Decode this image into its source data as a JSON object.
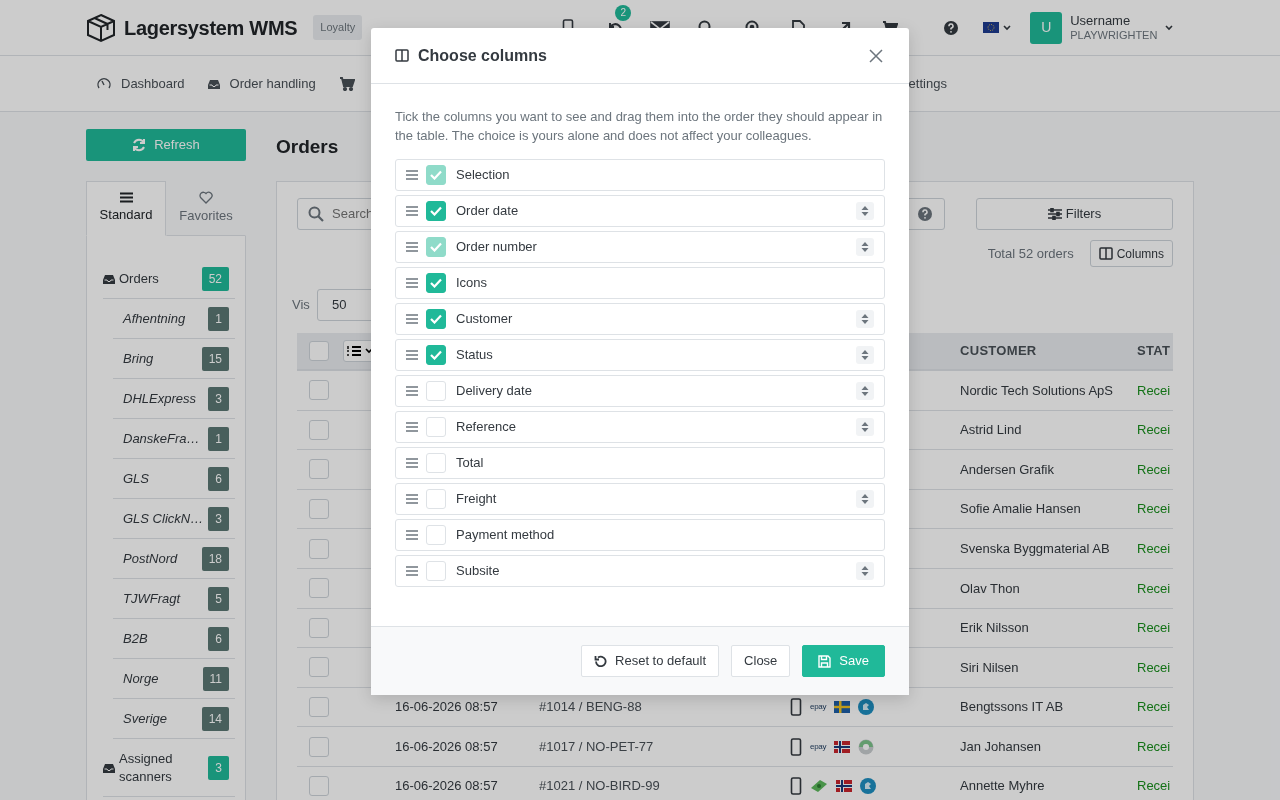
{
  "header": {
    "brand": "Lagersystem WMS",
    "plan_badge": "Loyalty",
    "notification_count": "2",
    "user": {
      "initial": "U",
      "name": "Username",
      "company": "PLAYWRIGHTEN"
    }
  },
  "subnav": [
    {
      "kind": "gauge",
      "label": "Dashboard"
    },
    {
      "kind": "inbox",
      "label": "Order handling"
    },
    {
      "kind": "cart"
    },
    {
      "kind": "plain",
      "label": "ettings"
    }
  ],
  "refresh_button": "Refresh",
  "page_title": "Orders",
  "sidebar": {
    "tabs": [
      {
        "kind": "list",
        "label": "Standard",
        "selected": true
      },
      {
        "kind": "heart",
        "label": "Favorites",
        "selected": false
      }
    ],
    "items": [
      {
        "kind": "folder",
        "label": "Orders",
        "count": "52"
      },
      {
        "kind": "carrier",
        "label": "Afhentning",
        "count": "1"
      },
      {
        "kind": "carrier",
        "label": "Bring",
        "count": "15"
      },
      {
        "kind": "carrier",
        "label": "DHLExpress",
        "count": "3"
      },
      {
        "kind": "carrier",
        "label": "DanskeFra…",
        "count": "1"
      },
      {
        "kind": "carrier",
        "label": "GLS",
        "count": "6"
      },
      {
        "kind": "carrier",
        "label": "GLS ClickN…",
        "count": "3"
      },
      {
        "kind": "carrier",
        "label": "PostNord",
        "count": "18"
      },
      {
        "kind": "carrier",
        "label": "TJWFragt",
        "count": "5"
      },
      {
        "kind": "carrier",
        "label": "B2B",
        "count": "6"
      },
      {
        "kind": "carrier",
        "label": "Norge",
        "count": "11"
      },
      {
        "kind": "carrier",
        "label": "Sverige",
        "count": "14"
      },
      {
        "kind": "folder",
        "label": "Assigned scanners",
        "count": "3"
      }
    ]
  },
  "toolbar": {
    "search_placeholder": "Search",
    "filters_button": "Filters",
    "total": "Total 52 orders",
    "columns_button": "Columns",
    "page_size_label": "Vis",
    "page_size": "50"
  },
  "table": {
    "select_all_checked": false,
    "columns": [
      "CUSTOMER",
      "STAT"
    ],
    "rows": [
      {
        "checked": false,
        "customer": "Nordic Tech Solutions ApS",
        "status": "Recei"
      },
      {
        "checked": false,
        "customer": "Astrid Lind",
        "status": "Recei"
      },
      {
        "checked": false,
        "customer": "Andersen Grafik",
        "status": "Recei"
      },
      {
        "checked": false,
        "customer": "Sofie Amalie Hansen",
        "status": "Recei"
      },
      {
        "checked": false,
        "customer": "Svenska Byggmaterial AB",
        "status": "Recei"
      },
      {
        "checked": false,
        "customer": "Olav Thon",
        "status": "Recei"
      },
      {
        "checked": false,
        "customer": "Erik Nilsson",
        "status": "Recei"
      },
      {
        "checked": false,
        "customer": "Siri Nilsen",
        "status": "Recei"
      },
      {
        "checked": false,
        "date": "16-06-2026 08:57",
        "order": "#1014 / BENG-88",
        "icons": [
          {
            "kind": "phone"
          },
          {
            "kind": "logo",
            "text": "epay"
          },
          {
            "kind": "flag_se"
          },
          {
            "kind": "carrier_blue"
          }
        ],
        "customer": "Bengtssons IT AB",
        "status": "Recei"
      },
      {
        "checked": false,
        "date": "16-06-2026 08:57",
        "order": "#1017 / NO-PET-77",
        "icons": [
          {
            "kind": "phone"
          },
          {
            "kind": "logo",
            "text": "epay"
          },
          {
            "kind": "flag_no"
          },
          {
            "kind": "carrier_ring"
          }
        ],
        "customer": "Jan Johansen",
        "status": "Recei"
      },
      {
        "checked": false,
        "date": "16-06-2026 08:57",
        "order": "#1021 / NO-BIRD-99",
        "icons": [
          {
            "kind": "phone"
          },
          {
            "kind": "cash"
          },
          {
            "kind": "flag_no"
          },
          {
            "kind": "carrier_blue"
          }
        ],
        "customer": "Annette Myhre",
        "status": "Recei"
      }
    ]
  },
  "modal": {
    "title": "Choose columns",
    "intro": "Tick the columns you want to see and drag them into the order they should appear in the table. The choice is yours alone and does not affect your colleagues.",
    "columns": [
      {
        "label": "Selection",
        "checked": true,
        "disabled": true,
        "sortable": false
      },
      {
        "label": "Order date",
        "checked": true,
        "disabled": false,
        "sortable": true
      },
      {
        "label": "Order number",
        "checked": true,
        "disabled": true,
        "sortable": true
      },
      {
        "label": "Icons",
        "checked": true,
        "disabled": false,
        "sortable": false
      },
      {
        "label": "Customer",
        "checked": true,
        "disabled": false,
        "sortable": true
      },
      {
        "label": "Status",
        "checked": true,
        "disabled": false,
        "sortable": true
      },
      {
        "label": "Delivery date",
        "checked": false,
        "disabled": false,
        "sortable": true
      },
      {
        "label": "Reference",
        "checked": false,
        "disabled": false,
        "sortable": true
      },
      {
        "label": "Total",
        "checked": false,
        "disabled": false,
        "sortable": false
      },
      {
        "label": "Freight",
        "checked": false,
        "disabled": false,
        "sortable": true
      },
      {
        "label": "Payment method",
        "checked": false,
        "disabled": false,
        "sortable": false
      },
      {
        "label": "Subsite",
        "checked": false,
        "disabled": false,
        "sortable": true
      }
    ],
    "buttons": {
      "reset": "Reset to default",
      "close": "Close",
      "save": "Save"
    }
  }
}
